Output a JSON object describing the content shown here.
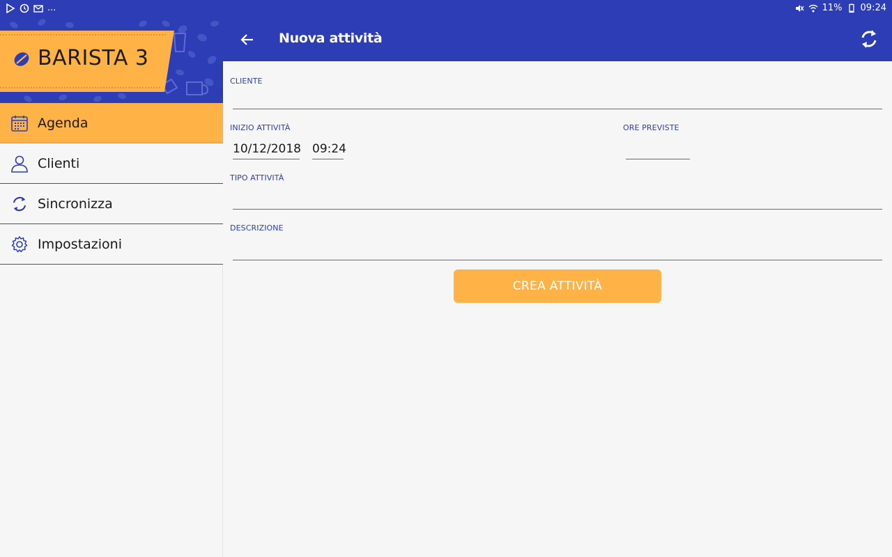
{
  "status_bar": {
    "left_dots": "...",
    "battery": "11%",
    "time": "09:24"
  },
  "app_bar": {
    "title": "Nuova attività"
  },
  "sidebar": {
    "brand": "BARISTA 3",
    "items": [
      {
        "label": "Agenda",
        "icon": "calendar-icon",
        "active": true
      },
      {
        "label": "Clienti",
        "icon": "user-icon",
        "active": false
      },
      {
        "label": "Sincronizza",
        "icon": "sync-icon",
        "active": false
      },
      {
        "label": "Impostazioni",
        "icon": "gear-icon",
        "active": false
      }
    ]
  },
  "form": {
    "cliente_label": "CLIENTE",
    "cliente_value": "",
    "inizio_label": "INIZIO ATTIVITÀ",
    "date_value": "10/12/2018",
    "time_value": "09:24",
    "ore_label": "ORE PREVISTE",
    "ore_value": "",
    "tipo_label": "TIPO ATTIVITÀ",
    "tipo_value": "",
    "descrizione_label": "DESCRIZIONE",
    "descrizione_value": "",
    "submit_label": "CREA ATTIVITÀ"
  },
  "colors": {
    "primary": "#2c3db5",
    "accent": "#ffb347",
    "background": "#f6f6f6"
  }
}
